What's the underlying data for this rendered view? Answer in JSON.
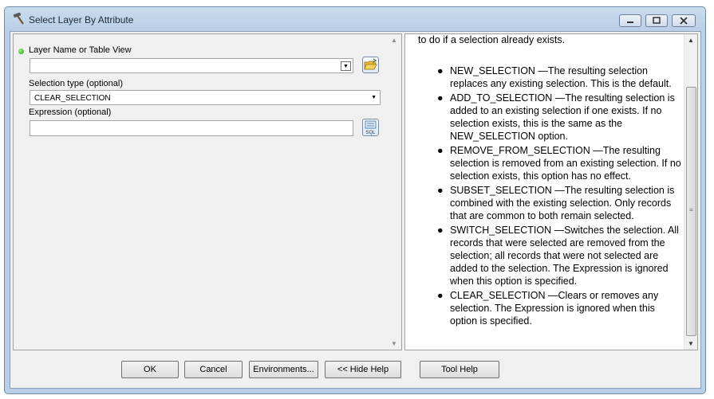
{
  "window": {
    "title": "Select Layer By Attribute"
  },
  "params": {
    "layer_label": "Layer Name or Table View",
    "layer_value": "",
    "selection_type_label": "Selection type (optional)",
    "selection_type_value": "CLEAR_SELECTION",
    "expression_label": "Expression (optional)",
    "expression_value": "",
    "sql_icon_text": "SQL"
  },
  "help": {
    "intro": "to do if a selection already exists.",
    "items": [
      "NEW_SELECTION —The resulting selection replaces any existing selection. This is the default.",
      "ADD_TO_SELECTION —The resulting selection is added to an existing selection if one exists. If no selection exists, this is the same as the NEW_SELECTION option.",
      "REMOVE_FROM_SELECTION —The resulting selection is removed from an existing selection. If no selection exists, this option has no effect.",
      "SUBSET_SELECTION —The resulting selection is combined with the existing selection. Only records that are common to both remain selected.",
      "SWITCH_SELECTION —Switches the selection. All records that were selected are removed from the selection; all records that were not selected are added to the selection. The Expression is ignored when this option is specified.",
      "CLEAR_SELECTION —Clears or removes any selection. The Expression is ignored when this option is specified."
    ]
  },
  "buttons": {
    "ok": "OK",
    "cancel": "Cancel",
    "environments": "Environments...",
    "hide_help": "<< Hide Help",
    "tool_help": "Tool Help"
  },
  "icons": {
    "title": "hammer-icon",
    "folder": "open-folder-icon",
    "sql": "sql-builder-icon"
  }
}
